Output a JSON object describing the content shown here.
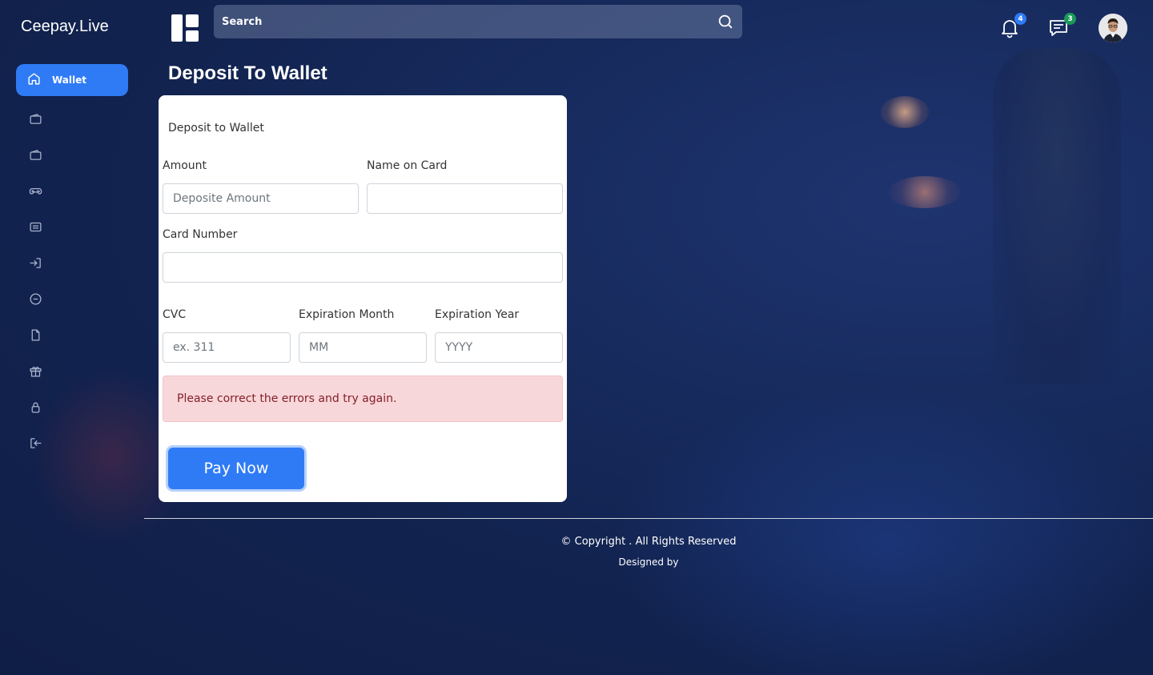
{
  "brand": "Ceepay.Live",
  "search": {
    "placeholder": "Search"
  },
  "notifications": {
    "count": "4"
  },
  "messages": {
    "count": "3"
  },
  "sidebar": {
    "active": {
      "label": "Wallet",
      "icon": "home-icon"
    },
    "items": [
      {
        "icon": "wallet-icon"
      },
      {
        "icon": "wallet-alt-icon"
      },
      {
        "icon": "gamepad-icon"
      },
      {
        "icon": "list-icon"
      },
      {
        "icon": "login-icon"
      },
      {
        "icon": "minus-circle-icon"
      },
      {
        "icon": "file-icon"
      },
      {
        "icon": "gift-icon"
      },
      {
        "icon": "lock-icon"
      },
      {
        "icon": "logout-icon"
      }
    ]
  },
  "page": {
    "title": "Deposit To Wallet",
    "form": {
      "subtitle": "Deposit to Wallet",
      "amount": {
        "label": "Amount",
        "placeholder": "Deposite Amount",
        "value": ""
      },
      "name_on_card": {
        "label": "Name on Card",
        "placeholder": "",
        "value": ""
      },
      "card_number": {
        "label": "Card Number",
        "placeholder": "",
        "value": ""
      },
      "cvc": {
        "label": "CVC",
        "placeholder": "ex. 311",
        "value": ""
      },
      "exp_month": {
        "label": "Expiration Month",
        "placeholder": "MM",
        "value": ""
      },
      "exp_year": {
        "label": "Expiration Year",
        "placeholder": "YYYY",
        "value": ""
      },
      "error": "Please correct the errors and try again.",
      "submit_label": "Pay Now"
    }
  },
  "footer": {
    "copyright": "© Copyright . All Rights Reserved",
    "designed_by": "Designed by"
  },
  "colors": {
    "accent": "#2f7bf6",
    "alert_bg": "#f8d7da",
    "alert_text": "#842029",
    "badge_green": "#1a9a57"
  }
}
